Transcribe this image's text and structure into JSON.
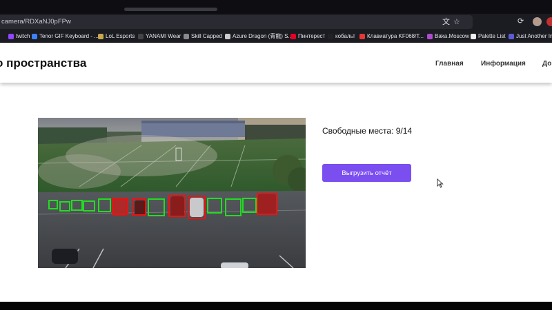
{
  "browser": {
    "url": "camera/RDXaNJ0pFPw",
    "bookmarks": [
      {
        "label": "twitch",
        "color": "#9146ff"
      },
      {
        "label": "Tenor GIF Keyboard - ...",
        "color": "#3b82f6"
      },
      {
        "label": "LoL Esports",
        "color": "#c9a84c"
      },
      {
        "label": "YANAMI Wear",
        "color": "#444444"
      },
      {
        "label": "Skill Capped",
        "color": "#8a8a8a"
      },
      {
        "label": "Azure Dragon (青龍) S...",
        "color": "#cccccc"
      },
      {
        "label": "Пинтерест",
        "color": "#e60023"
      },
      {
        "label": "кобальт",
        "color": "#222222"
      },
      {
        "label": "Клавиатура KF068/T...",
        "color": "#e53935"
      },
      {
        "label": "Baka.Moscow",
        "color": "#b04ad0"
      },
      {
        "label": "Palette List",
        "color": "#eeeeee"
      },
      {
        "label": "Just Another Im",
        "color": "#5b5bd6"
      }
    ]
  },
  "site": {
    "title": "о пространства",
    "nav": [
      "Главная",
      "Информация",
      "До"
    ]
  },
  "camera": {
    "spots_total": 14,
    "spots_free": 9,
    "spot_states": [
      "free",
      "free",
      "free",
      "free",
      "free",
      "occupied",
      "occupied",
      "free",
      "occupied",
      "occupied",
      "free",
      "free",
      "free",
      "occupied"
    ]
  },
  "status": {
    "free_spots_text": "Свободные места: 9/14"
  },
  "actions": {
    "export_label": "Выгрузить отчёт"
  },
  "colors": {
    "accent": "#7b4ef0",
    "free_box": "#22dd22",
    "occupied_box": "#ee1111"
  }
}
